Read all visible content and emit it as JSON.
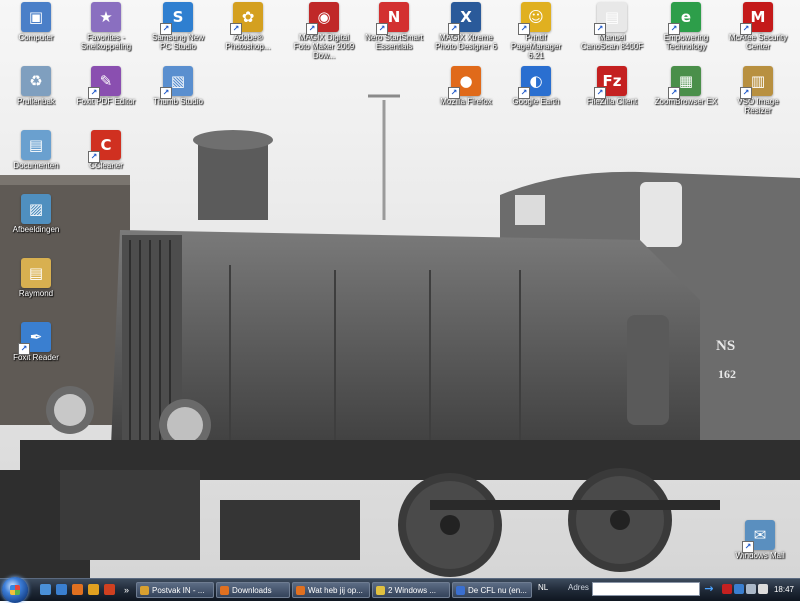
{
  "desktop": {
    "icons": [
      {
        "label": "Computer",
        "color": "#4a7fc8",
        "glyph": "▣"
      },
      {
        "label": "Favorites - Snelkoppeling",
        "color": "#8a6fc0",
        "glyph": "★"
      },
      {
        "label": "Samsung New PC Studio",
        "color": "#2f7fd0",
        "glyph": "S"
      },
      {
        "label": "Adobe® Photoshop...",
        "color": "#d4a020",
        "glyph": "✿"
      },
      {
        "label": "MAGIX Digital Foto Maker 2009 Dow...",
        "color": "#c02828",
        "glyph": "◉"
      },
      {
        "label": "Nero StartSmart Essentials",
        "color": "#d33030",
        "glyph": "N"
      },
      {
        "label": "MAGIX Xtreme Photo Designer 6",
        "color": "#2a5a9a",
        "glyph": "X"
      },
      {
        "label": "PrintIf PageManager 6.21",
        "color": "#e0b020",
        "glyph": "☺"
      },
      {
        "label": "Manuel CanoScan 8400F",
        "color": "#e8e8e8",
        "glyph": "▤"
      },
      {
        "label": "Empowering Technology",
        "color": "#2d9e4a",
        "glyph": "e"
      },
      {
        "label": "McAfee Security Center",
        "color": "#c41a1a",
        "glyph": "M"
      },
      {
        "label": "Prullenbak",
        "color": "#7f9fbf",
        "glyph": "♻"
      },
      {
        "label": "Foxit PDF Editor",
        "color": "#8a4fb0",
        "glyph": "✎"
      },
      {
        "label": "Thumb Studio",
        "color": "#5a8fcf",
        "glyph": "▧"
      },
      {
        "label": "Mozilla Firefox",
        "color": "#e06a1a",
        "glyph": "●"
      },
      {
        "label": "Google Earth",
        "color": "#2a6fd0",
        "glyph": "◐"
      },
      {
        "label": "FileZilla Client",
        "color": "#c42020",
        "glyph": "Fz"
      },
      {
        "label": "ZoomBrowser EX",
        "color": "#4a8f4a",
        "glyph": "▦"
      },
      {
        "label": "VSO Image Resizer",
        "color": "#b89040",
        "glyph": "▥"
      },
      {
        "label": "Documenten",
        "color": "#6aa0cf",
        "glyph": "▤"
      },
      {
        "label": "CCleaner",
        "color": "#d03020",
        "glyph": "C"
      },
      {
        "label": "Afbeeldingen",
        "color": "#4f8fbf",
        "glyph": "▨"
      },
      {
        "label": "Raymond",
        "color": "#d8b050",
        "glyph": "▤"
      },
      {
        "label": "Foxit Reader",
        "color": "#3a7fd0",
        "glyph": "✒"
      },
      {
        "label": "Windows Mail",
        "color": "#5a8fbf",
        "glyph": "✉"
      }
    ],
    "wallpaper_plate": [
      "NS",
      "162"
    ]
  },
  "taskbar": {
    "tasks": [
      {
        "label": "Postvak IN - ...",
        "color": "#d8a030"
      },
      {
        "label": "Downloads",
        "color": "#e07020"
      },
      {
        "label": "Wat heb jij op...",
        "color": "#e07020"
      },
      {
        "label": "2 Windows ...",
        "color": "#e0c040"
      },
      {
        "label": "De CFL nu (en...",
        "color": "#3a6fd0"
      }
    ],
    "quicklaunch": [
      "#4a90d8",
      "#3a7fd0",
      "#e07020",
      "#e0a020",
      "#d04020"
    ],
    "lang": "NL",
    "address_label": "Adres",
    "address_value": "",
    "go": "→",
    "tray": [
      "#c42020",
      "#3a7fd0",
      "#aab8c8",
      "#dcdcdc"
    ],
    "clock": "18:47"
  }
}
